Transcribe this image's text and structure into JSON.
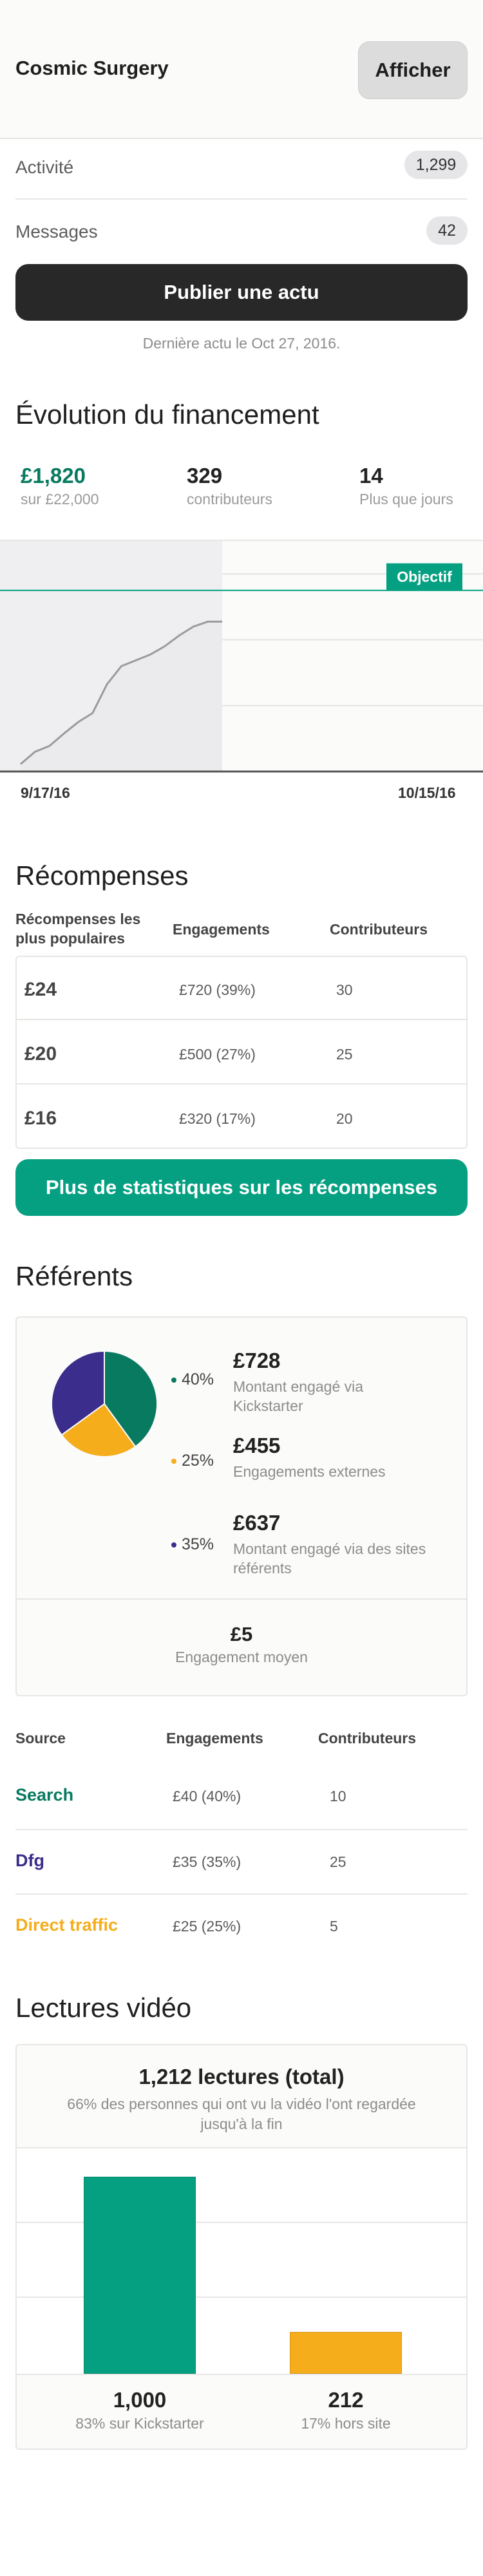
{
  "header": {
    "title": "Cosmic Surgery",
    "view_label": "Afficher"
  },
  "activity": {
    "label": "Activité",
    "count": "1,299"
  },
  "messages": {
    "label": "Messages",
    "count": "42"
  },
  "publish": {
    "label": "Publier une actu",
    "last_update": "Dernière actu le Oct 27, 2016."
  },
  "funding": {
    "title": "Évolution du financement",
    "pledged": "£1,820",
    "goal": "sur £22,000",
    "backers": "329",
    "backers_label": "contributeurs",
    "days": "14",
    "days_label": "Plus que jours",
    "goal_badge": "Objectif",
    "colors": {
      "accent": "#05a081",
      "line": "#9b9b9b"
    }
  },
  "chart_data": {
    "type": "area",
    "y_ticks": [
      "£24,000",
      "£16,000",
      "£8,000"
    ],
    "ylim": [
      0,
      28000
    ],
    "goal": 22000,
    "x_labels": [
      "9/17/16",
      "10/15/16"
    ],
    "days_total": 28,
    "days_elapsed": 14,
    "x": [
      0,
      1,
      2,
      3,
      4,
      5,
      6,
      7,
      8,
      9,
      10,
      11,
      12,
      13,
      14
    ],
    "values": [
      900,
      2400,
      3100,
      4600,
      6000,
      7100,
      10600,
      12800,
      13500,
      14200,
      15200,
      16500,
      17600,
      18200,
      18200
    ]
  },
  "rewards": {
    "title": "Récompenses",
    "col_reward": "Récompenses les plus populaires",
    "col_pledges": "Engagements",
    "col_backers": "Contributeurs",
    "rows": [
      {
        "amount": "£24",
        "pledges": "£720 (39%)",
        "backers": "30"
      },
      {
        "amount": "£20",
        "pledges": "£500 (27%)",
        "backers": "25"
      },
      {
        "amount": "£16",
        "pledges": "£320 (17%)",
        "backers": "20"
      }
    ],
    "more_stats": "Plus de statistiques sur les récompenses"
  },
  "referrers": {
    "title": "Référents",
    "pie": [
      {
        "pct": "40%",
        "value": 40,
        "amount": "£728",
        "desc": "Montant engagé via Kickstarter",
        "color": "#087a60"
      },
      {
        "pct": "25%",
        "value": 25,
        "amount": "£455",
        "desc": "Engagements externes",
        "color": "#f5ad1c"
      },
      {
        "pct": "35%",
        "value": 35,
        "amount": "£637",
        "desc": "Montant engagé via des sites référents",
        "color": "#3a2d8c"
      }
    ],
    "average": "£5",
    "average_label": "Engagement moyen",
    "col_source": "Source",
    "col_pledges": "Engagements",
    "col_backers": "Contributeurs",
    "sources": [
      {
        "name": "Search",
        "pledges": "£40 (40%)",
        "backers": "10",
        "color": "#087a60"
      },
      {
        "name": "Dfg",
        "pledges": "£35 (35%)",
        "backers": "25",
        "color": "#3a2d8c"
      },
      {
        "name": "Direct traffic",
        "pledges": "£25 (25%)",
        "backers": "5",
        "color": "#f5ad1c"
      }
    ]
  },
  "video": {
    "title": "Lectures vidéo",
    "total": "1,212 lectures (total)",
    "completion": "66% des personnes qui ont vu la vidéo l'ont regardée jusqu'à la fin",
    "bars": [
      {
        "count": "1,000",
        "value": 1000,
        "label": "83% sur Kickstarter",
        "color": "#05a081"
      },
      {
        "count": "212",
        "value": 212,
        "label": "17% hors site",
        "color": "#f5ad1c"
      }
    ],
    "ymax": 1150
  }
}
